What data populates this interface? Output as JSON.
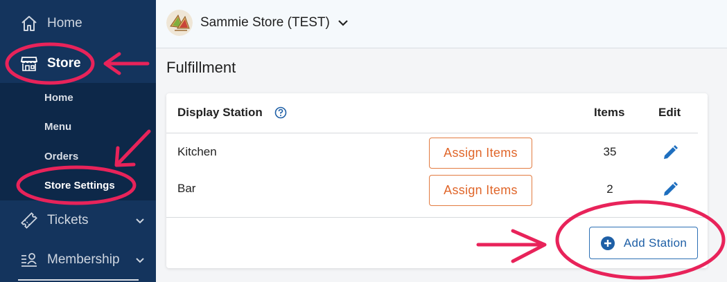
{
  "sidebar": {
    "items": [
      {
        "label": "Home",
        "icon": "home-icon"
      },
      {
        "label": "Store",
        "icon": "store-icon"
      },
      {
        "label": "Tickets",
        "icon": "ticket-icon"
      },
      {
        "label": "Membership",
        "icon": "membership-icon"
      }
    ],
    "subitems": [
      "Home",
      "Menu",
      "Orders",
      "Store Settings"
    ]
  },
  "header": {
    "store_name": "Sammie Store (TEST)"
  },
  "page": {
    "title": "Fulfillment"
  },
  "table": {
    "headers": {
      "station": "Display Station",
      "items": "Items",
      "edit": "Edit"
    },
    "rows": [
      {
        "name": "Kitchen",
        "assign_label": "Assign Items",
        "items": "35"
      },
      {
        "name": "Bar",
        "assign_label": "Assign Items",
        "items": "2"
      }
    ],
    "add_label": "Add Station"
  },
  "colors": {
    "sidebar": "#14345d",
    "accent_orange": "#e0662a",
    "accent_blue": "#1e5fa6",
    "annotation": "#e8235a"
  }
}
